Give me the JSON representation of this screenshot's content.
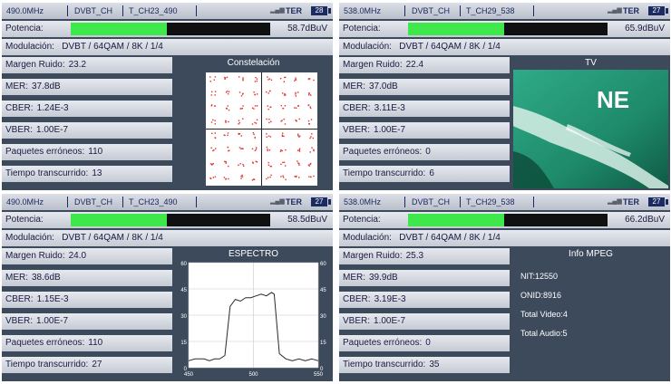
{
  "panels": [
    {
      "header": {
        "freq": "490.0MHz",
        "network": "DVBT_CH",
        "channel": "T_CH23_490",
        "signal_icon": "signal-bars-icon",
        "source": "TER",
        "badge": "28"
      },
      "power": {
        "label": "Potencia:",
        "value": "58.7dBuV",
        "level_fraction": 0.48
      },
      "modulation": "Modulación:   DVBT / 64QAM / 8K / 1/4",
      "measures": [
        {
          "label": "Margen Ruido:",
          "value": "23.2"
        },
        {
          "label": "MER:",
          "value": "37.8dB"
        },
        {
          "label": "CBER:",
          "value": "1.24E-3"
        },
        {
          "label": "VBER:",
          "value": "1.00E-7"
        },
        {
          "label": "Paquetes erróneos:",
          "value": "110"
        },
        {
          "label": "Tiempo transcurrido:",
          "value": "13"
        }
      ],
      "graph": {
        "type": "constellation",
        "title": "Constelación"
      }
    },
    {
      "header": {
        "freq": "538.0MHz",
        "network": "DVBT_CH",
        "channel": "T_CH29_538",
        "signal_icon": "signal-bars-icon",
        "source": "TER",
        "badge": "27"
      },
      "power": {
        "label": "Potencia:",
        "value": "65.9dBuV",
        "level_fraction": 0.48
      },
      "modulation": "Modulación:   DVBT / 64QAM / 8K / 1/4",
      "measures": [
        {
          "label": "Margen Ruido:",
          "value": "22.4"
        },
        {
          "label": "MER:",
          "value": "37.0dB"
        },
        {
          "label": "CBER:",
          "value": "3.11E-3"
        },
        {
          "label": "VBER:",
          "value": "1.00E-7"
        },
        {
          "label": "Paquetes erróneos:",
          "value": "0"
        },
        {
          "label": "Tiempo transcurrido:",
          "value": "6"
        }
      ],
      "graph": {
        "type": "tv",
        "title": "TV",
        "overlay": "NE"
      }
    },
    {
      "header": {
        "freq": "490.0MHz",
        "network": "DVBT_CH",
        "channel": "T_CH23_490",
        "signal_icon": "signal-bars-icon",
        "source": "TER",
        "badge": "27"
      },
      "power": {
        "label": "Potencia:",
        "value": "58.5dBuV",
        "level_fraction": 0.48
      },
      "modulation": "Modulación:   DVBT / 64QAM / 8K / 1/4",
      "measures": [
        {
          "label": "Margen Ruido:",
          "value": "24.0"
        },
        {
          "label": "MER:",
          "value": "38.6dB"
        },
        {
          "label": "CBER:",
          "value": "1.15E-3"
        },
        {
          "label": "VBER:",
          "value": "1.00E-7"
        },
        {
          "label": "Paquetes erróneos:",
          "value": "110"
        },
        {
          "label": "Tiempo transcurrido:",
          "value": "27"
        }
      ],
      "graph": {
        "type": "spectrum",
        "title": "ESPECTRO"
      }
    },
    {
      "header": {
        "freq": "538.0MHz",
        "network": "DVBT_CH",
        "channel": "T_CH29_538",
        "signal_icon": "signal-bars-icon",
        "source": "TER",
        "badge": "27"
      },
      "power": {
        "label": "Potencia:",
        "value": "66.2dBuV",
        "level_fraction": 0.48
      },
      "modulation": "Modulación:   DVBT / 64QAM / 8K / 1/4",
      "measures": [
        {
          "label": "Margen Ruido:",
          "value": "25.3"
        },
        {
          "label": "MER:",
          "value": "39.9dB"
        },
        {
          "label": "CBER:",
          "value": "3.19E-3"
        },
        {
          "label": "VBER:",
          "value": "1.00E-7"
        },
        {
          "label": "Paquetes erróneos:",
          "value": "0"
        },
        {
          "label": "Tiempo transcurrido:",
          "value": "35"
        }
      ],
      "graph": {
        "type": "info",
        "title": "Info MPEG",
        "lines": [
          "NIT:12550",
          "ONID:8916",
          "Total Video:4",
          "Total Audio:5"
        ]
      }
    }
  ],
  "chart_data": {
    "type": "line",
    "title": "ESPECTRO",
    "x": [
      450,
      455,
      460,
      462,
      466,
      470,
      474,
      478,
      482,
      486,
      490,
      494,
      498,
      502,
      506,
      510,
      514,
      516,
      520,
      525,
      530,
      535,
      540,
      545,
      550
    ],
    "y": [
      4,
      5,
      5,
      5,
      4,
      5,
      5,
      7,
      35,
      39,
      38,
      40,
      40,
      41,
      42,
      41,
      43,
      42,
      8,
      5,
      4,
      5,
      4,
      5,
      4
    ],
    "xlim": [
      450,
      550
    ],
    "ylim": [
      0,
      60
    ],
    "x_ticks": [
      450,
      500,
      550
    ],
    "y_ticks": [
      0,
      15,
      30,
      45,
      60
    ],
    "grid": true,
    "colors": {
      "line": "#2a2a2a",
      "background": "#ffffff",
      "grid": "#c8c8c8"
    }
  },
  "colors": {
    "panel": "#3d4a5c",
    "power_fill": "#3fe84a",
    "constellation_points": "#e03030",
    "header_text": "#1b2a60"
  }
}
